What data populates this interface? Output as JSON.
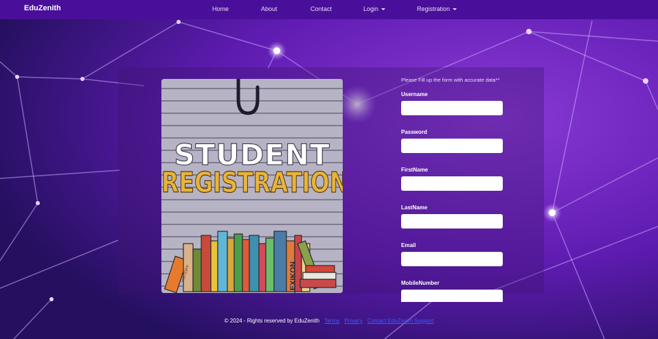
{
  "navbar": {
    "brand": "EduZenith",
    "items": [
      {
        "label": "Home"
      },
      {
        "label": "About"
      },
      {
        "label": "Contact"
      },
      {
        "label": "Login"
      },
      {
        "label": "Registration"
      }
    ]
  },
  "poster": {
    "title_line1": "STUDENT",
    "title_line2": "REGISTRATION",
    "book_spines": [
      "HISTORY",
      "LEXIKON"
    ]
  },
  "form": {
    "note": "Please Fill up the form with accurate data**",
    "fields": [
      {
        "label": "Username",
        "value": ""
      },
      {
        "label": "Password",
        "value": ""
      },
      {
        "label": "FirstName",
        "value": ""
      },
      {
        "label": "LastName",
        "value": ""
      },
      {
        "label": "Email",
        "value": ""
      },
      {
        "label": "MobileNumber",
        "value": ""
      }
    ]
  },
  "footer": {
    "copyright": "© 2024 - Rights reserved by EduZenith",
    "links": [
      "Terms",
      "Privacy",
      "Contact EduZenith Support"
    ]
  },
  "colors": {
    "navbar": "#4a0f9a",
    "background": "#2a0d6b",
    "accent_purple": "#8a2be2",
    "poster_gold": "#e7b43c",
    "link": "#3d5bff"
  }
}
